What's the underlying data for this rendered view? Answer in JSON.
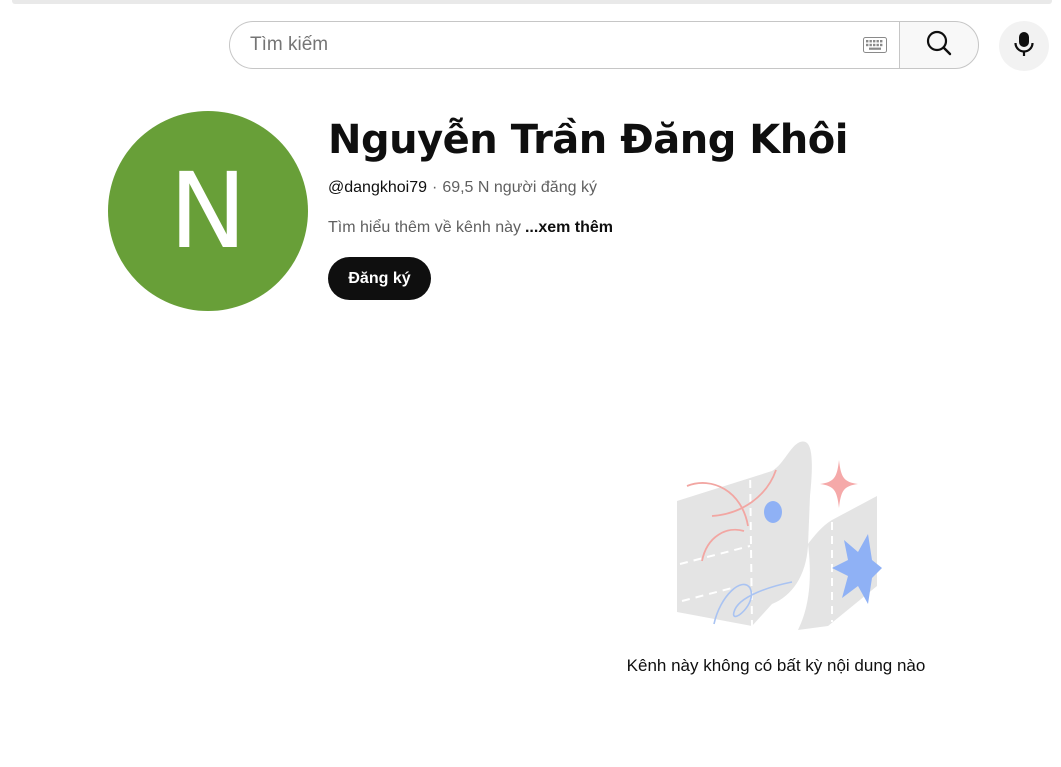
{
  "search": {
    "placeholder": "Tìm kiếm",
    "value": ""
  },
  "icons": {
    "keyboard": "keyboard-icon",
    "search": "search-icon",
    "mic": "mic-icon"
  },
  "channel": {
    "avatar_letter": "N",
    "avatar_color": "#689f38",
    "name": "Nguyễn Trần Đăng Khôi",
    "handle": "@dangkhoi79",
    "separator": "·",
    "subscribers": "69,5 N người đăng ký",
    "about_text": "Tìm hiểu thêm về kênh này",
    "about_more": "...xem thêm",
    "subscribe_label": "Đăng ký"
  },
  "empty_state": {
    "message": "Kênh này không có bất kỳ nội dung nào"
  },
  "colors": {
    "accent_black": "#0f0f0f",
    "secondary_text": "#606060",
    "border": "#c6c6c6"
  }
}
